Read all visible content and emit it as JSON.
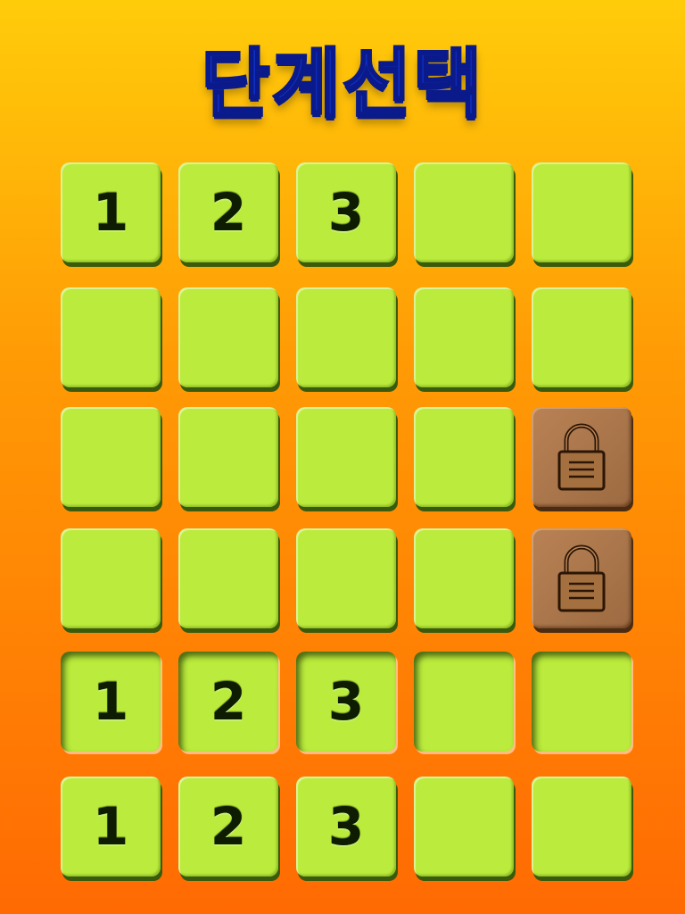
{
  "title": "단계선택",
  "colors": {
    "tile_green": "#bbeb3c",
    "tile_locked": "#9c6a41",
    "title_blue": "#1133cc",
    "number_color": "#0e1d02"
  },
  "rows": [
    {
      "tiles": [
        {
          "label": "1",
          "state": "normal"
        },
        {
          "label": "2",
          "state": "normal"
        },
        {
          "label": "3",
          "state": "normal"
        },
        {
          "label": "",
          "state": "normal"
        },
        {
          "label": "",
          "state": "normal"
        }
      ]
    },
    {
      "tiles": [
        {
          "label": "",
          "state": "normal"
        },
        {
          "label": "",
          "state": "normal"
        },
        {
          "label": "",
          "state": "normal"
        },
        {
          "label": "",
          "state": "normal"
        },
        {
          "label": "",
          "state": "normal"
        }
      ]
    },
    {
      "tiles": [
        {
          "label": "",
          "state": "normal"
        },
        {
          "label": "",
          "state": "normal"
        },
        {
          "label": "",
          "state": "normal"
        },
        {
          "label": "",
          "state": "normal"
        },
        {
          "label": "",
          "state": "locked",
          "icon": "lock-icon"
        }
      ]
    },
    {
      "tiles": [
        {
          "label": "",
          "state": "normal"
        },
        {
          "label": "",
          "state": "normal"
        },
        {
          "label": "",
          "state": "normal"
        },
        {
          "label": "",
          "state": "normal"
        },
        {
          "label": "",
          "state": "locked",
          "icon": "lock-icon"
        }
      ]
    },
    {
      "tiles": [
        {
          "label": "1",
          "state": "pressed"
        },
        {
          "label": "2",
          "state": "pressed"
        },
        {
          "label": "3",
          "state": "pressed"
        },
        {
          "label": "",
          "state": "pressed"
        },
        {
          "label": "",
          "state": "pressed"
        }
      ]
    },
    {
      "tiles": [
        {
          "label": "1",
          "state": "normal"
        },
        {
          "label": "2",
          "state": "normal"
        },
        {
          "label": "3",
          "state": "normal"
        },
        {
          "label": "",
          "state": "normal"
        },
        {
          "label": "",
          "state": "normal"
        }
      ]
    }
  ]
}
